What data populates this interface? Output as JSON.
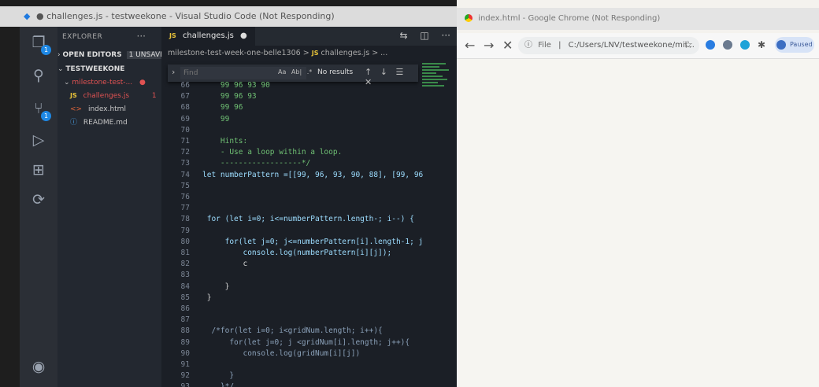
{
  "vscode": {
    "title": "● challenges.js - testweekone - Visual Studio Code (Not Responding)",
    "activity": {
      "explorer_badge": "1",
      "git_badge": "1"
    },
    "sidebar": {
      "header": "EXPLORER",
      "more": "···",
      "open_editors": "OPEN EDITORS",
      "unsaved": "1 UNSAVED",
      "workspace": "TESTWEEKONE",
      "folder": "milestone-test-...",
      "files": [
        {
          "name": "challenges.js",
          "type": "JS",
          "count": "1"
        },
        {
          "name": "index.html",
          "type": "<>"
        },
        {
          "name": "README.md",
          "type": "ⓘ"
        }
      ]
    },
    "tab": {
      "label": "challenges.js",
      "prefix": "JS"
    },
    "breadcrumb": {
      "folder": "milestone-test-week-one-belle1306",
      "sep": ">",
      "file": "challenges.js",
      "tail": "> ..."
    },
    "find": {
      "placeholder": "Find",
      "results": "No results",
      "opts": [
        "Aa",
        "Ab|",
        ".*"
      ]
    },
    "lines": [
      {
        "n": "66",
        "t": "    99 96 93 90"
      },
      {
        "n": "67",
        "t": "    99 96 93"
      },
      {
        "n": "68",
        "t": "    99 96"
      },
      {
        "n": "69",
        "t": "    99"
      },
      {
        "n": "70",
        "t": ""
      },
      {
        "n": "71",
        "t": "    Hints:"
      },
      {
        "n": "72",
        "t": "    - Use a loop within a loop."
      },
      {
        "n": "73",
        "t": "    ------------------*/"
      },
      {
        "n": "74",
        "t": "let numberPattern =[[99, 96, 93, 90, 88], [99, 96"
      },
      {
        "n": "75",
        "t": ""
      },
      {
        "n": "76",
        "t": ""
      },
      {
        "n": "77",
        "t": ""
      },
      {
        "n": "78",
        "t": " for (let i=0; i<=numberPattern.length-; i--) {"
      },
      {
        "n": "79",
        "t": ""
      },
      {
        "n": "80",
        "t": "     for(let j=0; j<=numberPattern[i].length-1; j"
      },
      {
        "n": "81",
        "t": "         console.log(numberPattern[i][j]);"
      },
      {
        "n": "82",
        "t": "         c"
      },
      {
        "n": "83",
        "t": ""
      },
      {
        "n": "84",
        "t": "     }"
      },
      {
        "n": "85",
        "t": " }"
      },
      {
        "n": "86",
        "t": ""
      },
      {
        "n": "87",
        "t": ""
      },
      {
        "n": "88",
        "t": "  /*for(let i=0; i<gridNum.length; i++){"
      },
      {
        "n": "89",
        "t": "      for(let j=0; j <gridNum[i].length; j++){"
      },
      {
        "n": "90",
        "t": "         console.log(gridNum[i][j])"
      },
      {
        "n": "91",
        "t": ""
      },
      {
        "n": "92",
        "t": "      }"
      },
      {
        "n": "93",
        "t": "    }*/"
      }
    ]
  },
  "chrome": {
    "title": "index.html - Google Chrome (Not Responding)",
    "omnibox": {
      "info": "ⓘ",
      "scheme": "File",
      "sep": "|",
      "url": "C:/Users/LNV/testweekone/mil..."
    },
    "paused": "Paused"
  },
  "colors": {
    "accent": "#1e88e5",
    "comment": "#6fbf73",
    "keyword": "#569cd6"
  }
}
